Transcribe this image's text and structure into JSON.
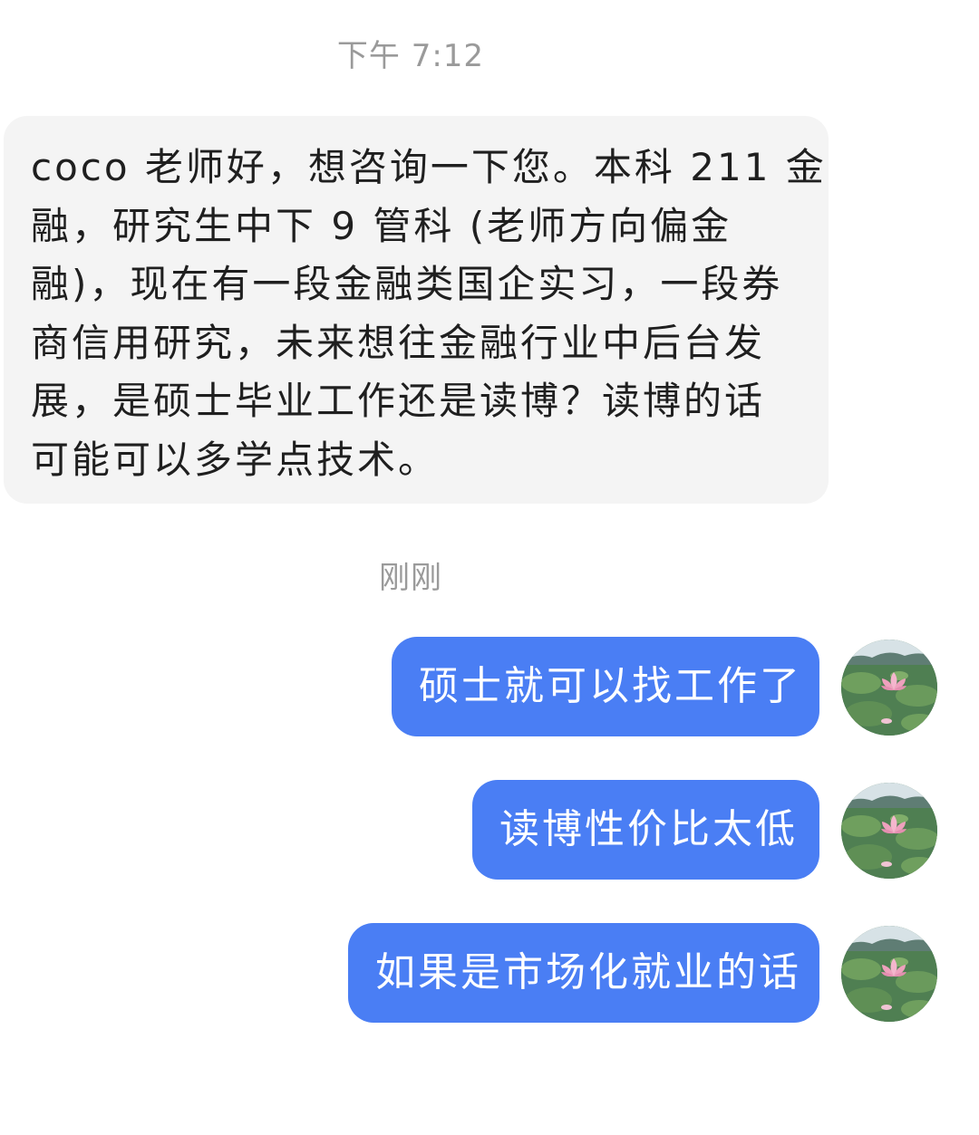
{
  "chat": {
    "timestamps": [
      "下午 7:12",
      "刚刚"
    ],
    "incoming_message": {
      "lines": [
        "coco 老师好，想咨询一下您。本科 211 金",
        "融，研究生中下 9 管科 (老师方向偏金",
        "融)，现在有一段金融类国企实习，一段券",
        "商信用研究，未来想往金融行业中后台发",
        "展，是硕士毕业工作还是读博？读博的话",
        "可能可以多学点技术。"
      ]
    },
    "outgoing_messages": [
      "硕士就可以找工作了",
      "读博性价比太低",
      "如果是市场化就业的话"
    ]
  },
  "colors": {
    "outgoing_bubble": "#4a7ef4",
    "incoming_bubble": "#f4f4f4",
    "timestamp_text": "#9a9a9a"
  },
  "avatar": {
    "icon": "lotus-pond-avatar-icon"
  }
}
